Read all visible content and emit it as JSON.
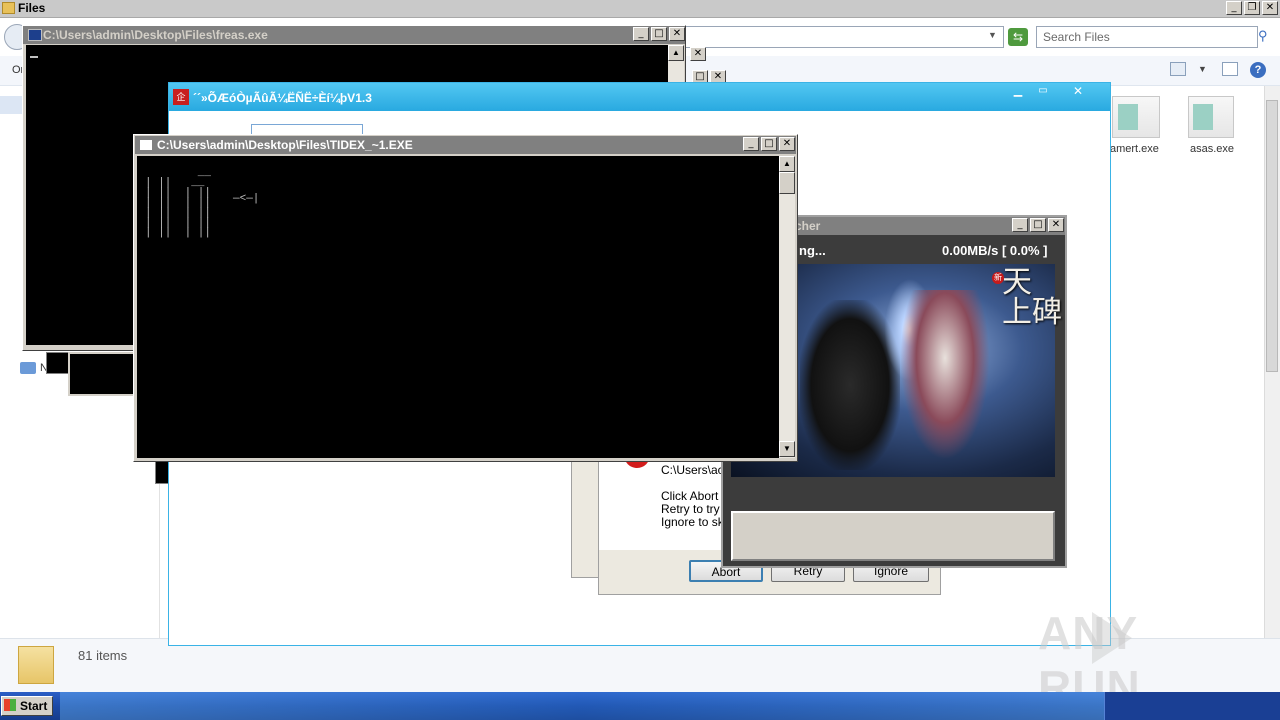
{
  "explorer": {
    "title": "Files",
    "search_placeholder": "Search Files",
    "toolbar_organize": "Or",
    "network_label": "N",
    "items_count": "81 items",
    "files": [
      {
        "label": "amert.exe"
      },
      {
        "label": "asas.exe"
      }
    ]
  },
  "freas_console": {
    "title": "C:\\Users\\admin\\Desktop\\Files\\freas.exe"
  },
  "app_window": {
    "title": "´´»ÕÆóÒµÃûÃ¼ËÑË÷Èí¼þV1.3"
  },
  "tidex_console": {
    "title": "C:\\Users\\admin\\Desktop\\Files\\TIDEX_~1.EXE",
    "art": "        __\n| ||   __\n| ||  | ||\n| ||  | ||\n| ||  | ||\n| ||  | ||\n| ||  | ||",
    "prompt": "—<—|"
  },
  "error_dialog": {
    "path": "C:\\Users\\ac",
    "line1": "Click Abort t",
    "line2": "Retry to try",
    "line3": "Ignore to sk",
    "buttons": {
      "abort": "Abort",
      "retry": "Retry",
      "ignore": "Ignore"
    }
  },
  "launcher": {
    "title": "cher",
    "status": "ng...",
    "speed": "0.00MB/s [ 0.0% ]",
    "progress_value": 0.0,
    "logo": "天\n上碑",
    "logo_badge": "新"
  },
  "taskbar": {
    "start_label": "Start"
  },
  "watermark": {
    "text_left": "ANY",
    "text_right": "RUN"
  },
  "icons": [
    "folder-icon",
    "search-icon",
    "refresh-icon",
    "help-icon",
    "view-icon",
    "network-icon",
    "console-icon",
    "app-icon",
    "error-icon",
    "start-logo-icon"
  ]
}
